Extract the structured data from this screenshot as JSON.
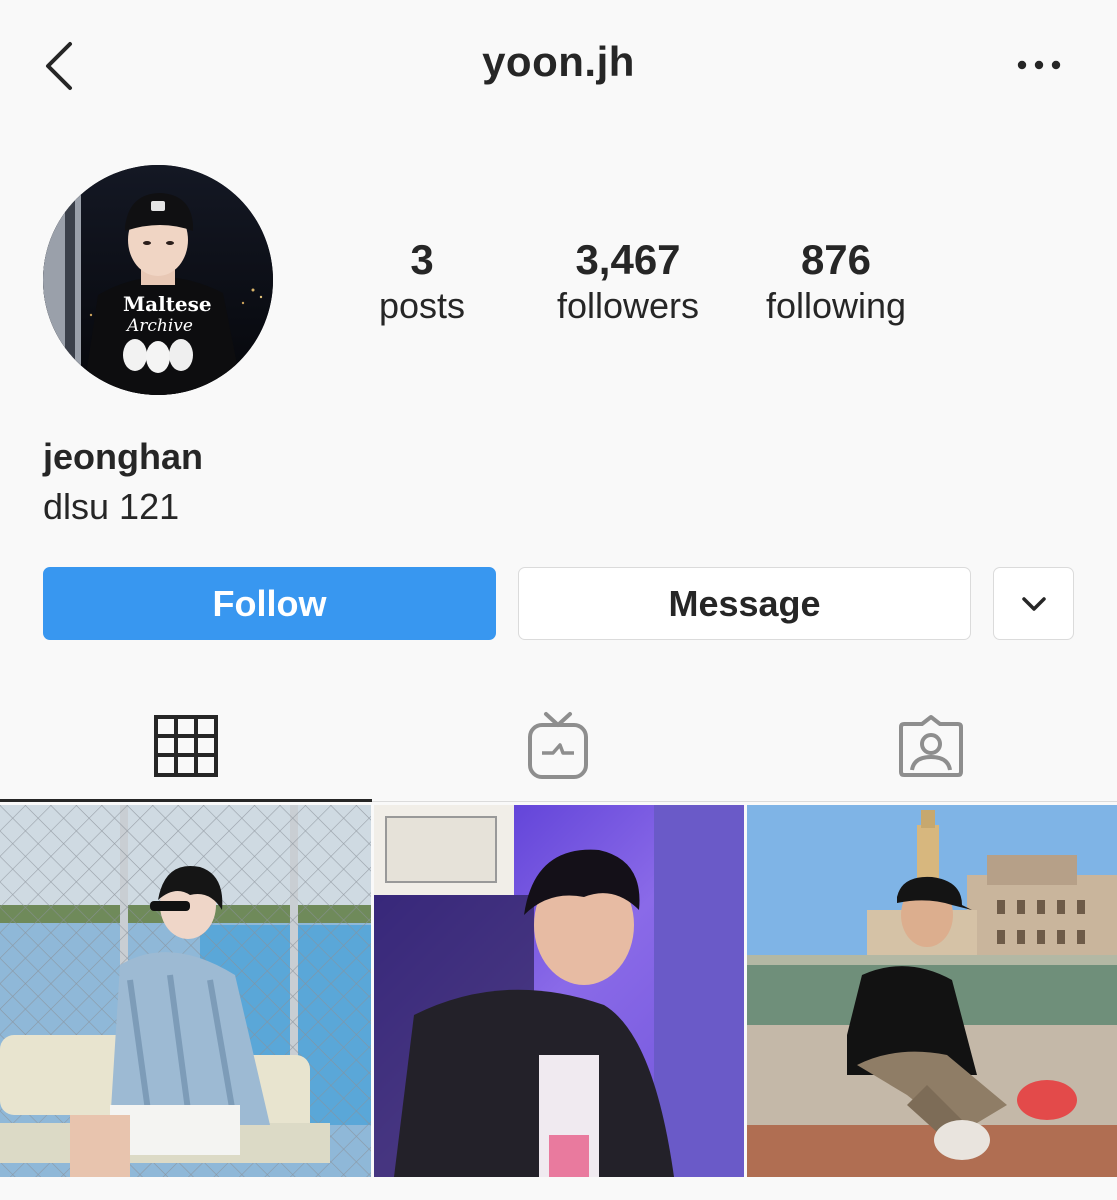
{
  "header": {
    "username": "yoon.jh",
    "back_icon": "chevron-left-icon",
    "more_icon": "more-horizontal-icon"
  },
  "profile": {
    "avatar": "profile-photo",
    "avatar_shirt_text": [
      "Maltese",
      "Archive"
    ],
    "stats": [
      {
        "value": "3",
        "label": "posts"
      },
      {
        "value": "3,467",
        "label": "followers"
      },
      {
        "value": "876",
        "label": "following"
      }
    ],
    "display_name": "jeonghan",
    "bio": "dlsu 121"
  },
  "actions": {
    "follow_label": "Follow",
    "message_label": "Message",
    "dropdown_icon": "chevron-down-icon"
  },
  "tabs": [
    {
      "name": "grid",
      "icon": "grid-icon",
      "active": true
    },
    {
      "name": "igtv",
      "icon": "igtv-icon",
      "active": false
    },
    {
      "name": "tagged",
      "icon": "tagged-person-icon",
      "active": false
    }
  ],
  "posts": [
    {
      "id": 1,
      "kind": "photo"
    },
    {
      "id": 2,
      "kind": "photo"
    },
    {
      "id": 3,
      "kind": "photo"
    }
  ],
  "colors": {
    "follow_blue": "#3897f0",
    "text": "#262626",
    "background": "#f9f9f9",
    "border": "#dbdbdb"
  }
}
